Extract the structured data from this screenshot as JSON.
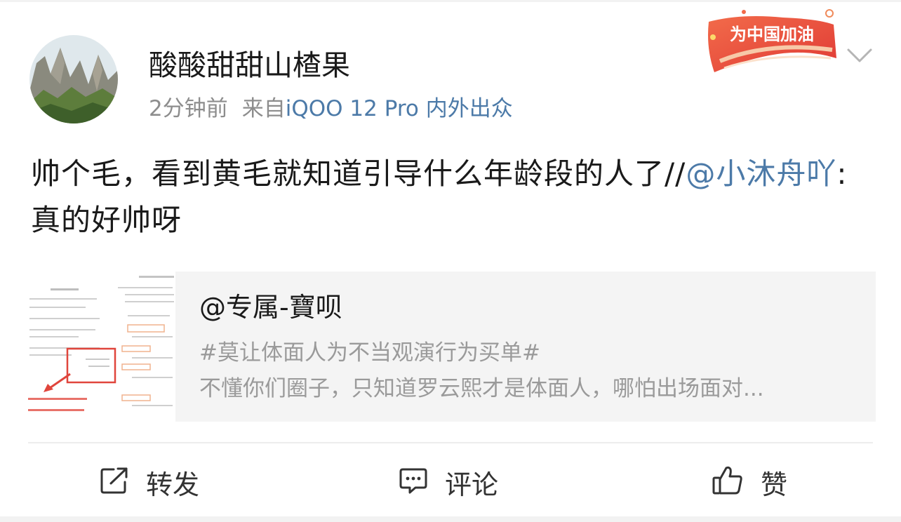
{
  "post": {
    "username": "酸酸甜甜山楂果",
    "time": "2分钟前",
    "source_prefix": "来自",
    "device": "iQOO 12 Pro 内外出众",
    "badge_text": "为中国加油",
    "text_main": "帅个毛，看到黄毛就知道引导什么年龄段的人了//",
    "mention": "@小沐舟吖",
    "text_after_mention": ":真的好帅呀"
  },
  "quote": {
    "user": "@专属-寶呗",
    "line1": "#莫让体面人为不当观演行为买单#",
    "line2": "不懂你们圈子，只知道罗云熙才是体面人，哪怕出场面对..."
  },
  "actions": {
    "repost_label": "转发",
    "comment_label": "评论",
    "like_label": "赞"
  },
  "colors": {
    "link": "#4c7aa8",
    "text": "#1a1a1a",
    "meta": "#8d8d8d",
    "badge": "#e8463a"
  },
  "icons": {
    "repost": "share-arrow-icon",
    "comment": "comment-bubble-icon",
    "like": "thumbs-up-icon",
    "more": "chevron-down-icon"
  }
}
